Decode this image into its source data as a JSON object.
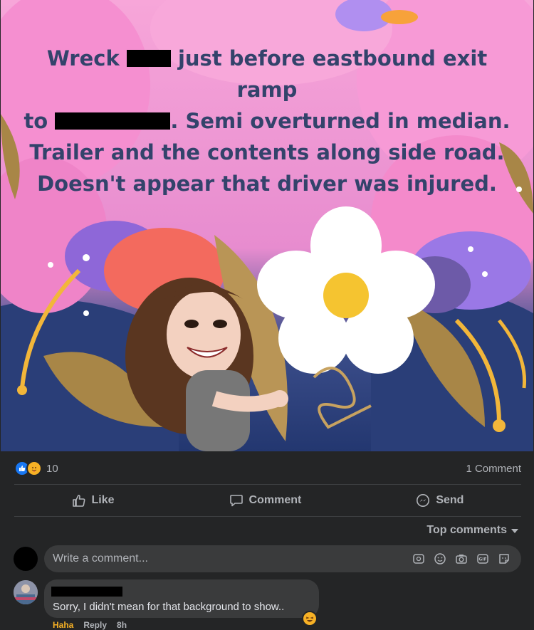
{
  "post": {
    "text": {
      "line1_a": "Wreck",
      "line1_b": "just before eastbound exit ramp",
      "line2_a": "to",
      "line2_b": ". Semi overturned in median.",
      "line3": "Trailer and the contents along side road.",
      "line4": "Doesn't appear that driver was injured."
    },
    "background_colors": {
      "pink": "#f49bd6",
      "navy": "#2a3e78",
      "white_flower": "#ffffff",
      "yellow": "#f5c430"
    }
  },
  "stats": {
    "reaction_icons": [
      "like-icon",
      "care-icon"
    ],
    "reaction_count": "10",
    "comment_count": "1 Comment"
  },
  "actions": {
    "like": "Like",
    "comment": "Comment",
    "send": "Send"
  },
  "comments_section": {
    "sort_label": "Top comments",
    "compose_placeholder": "Write a comment...",
    "compose_tools": [
      "sticker-icon",
      "emoji-icon",
      "camera-icon",
      "gif-icon",
      "avatar-sticker-icon"
    ]
  },
  "comment": {
    "text": "Sorry, I didn't mean for that background to show..",
    "meta": [
      "Haha",
      "Reply",
      "8h"
    ]
  },
  "colors": {
    "background": "#242526",
    "bubble": "#3a3b3c",
    "muted_text": "#b0b3b8",
    "like_blue": "#1877f2",
    "haha_yellow": "#f7b125"
  }
}
